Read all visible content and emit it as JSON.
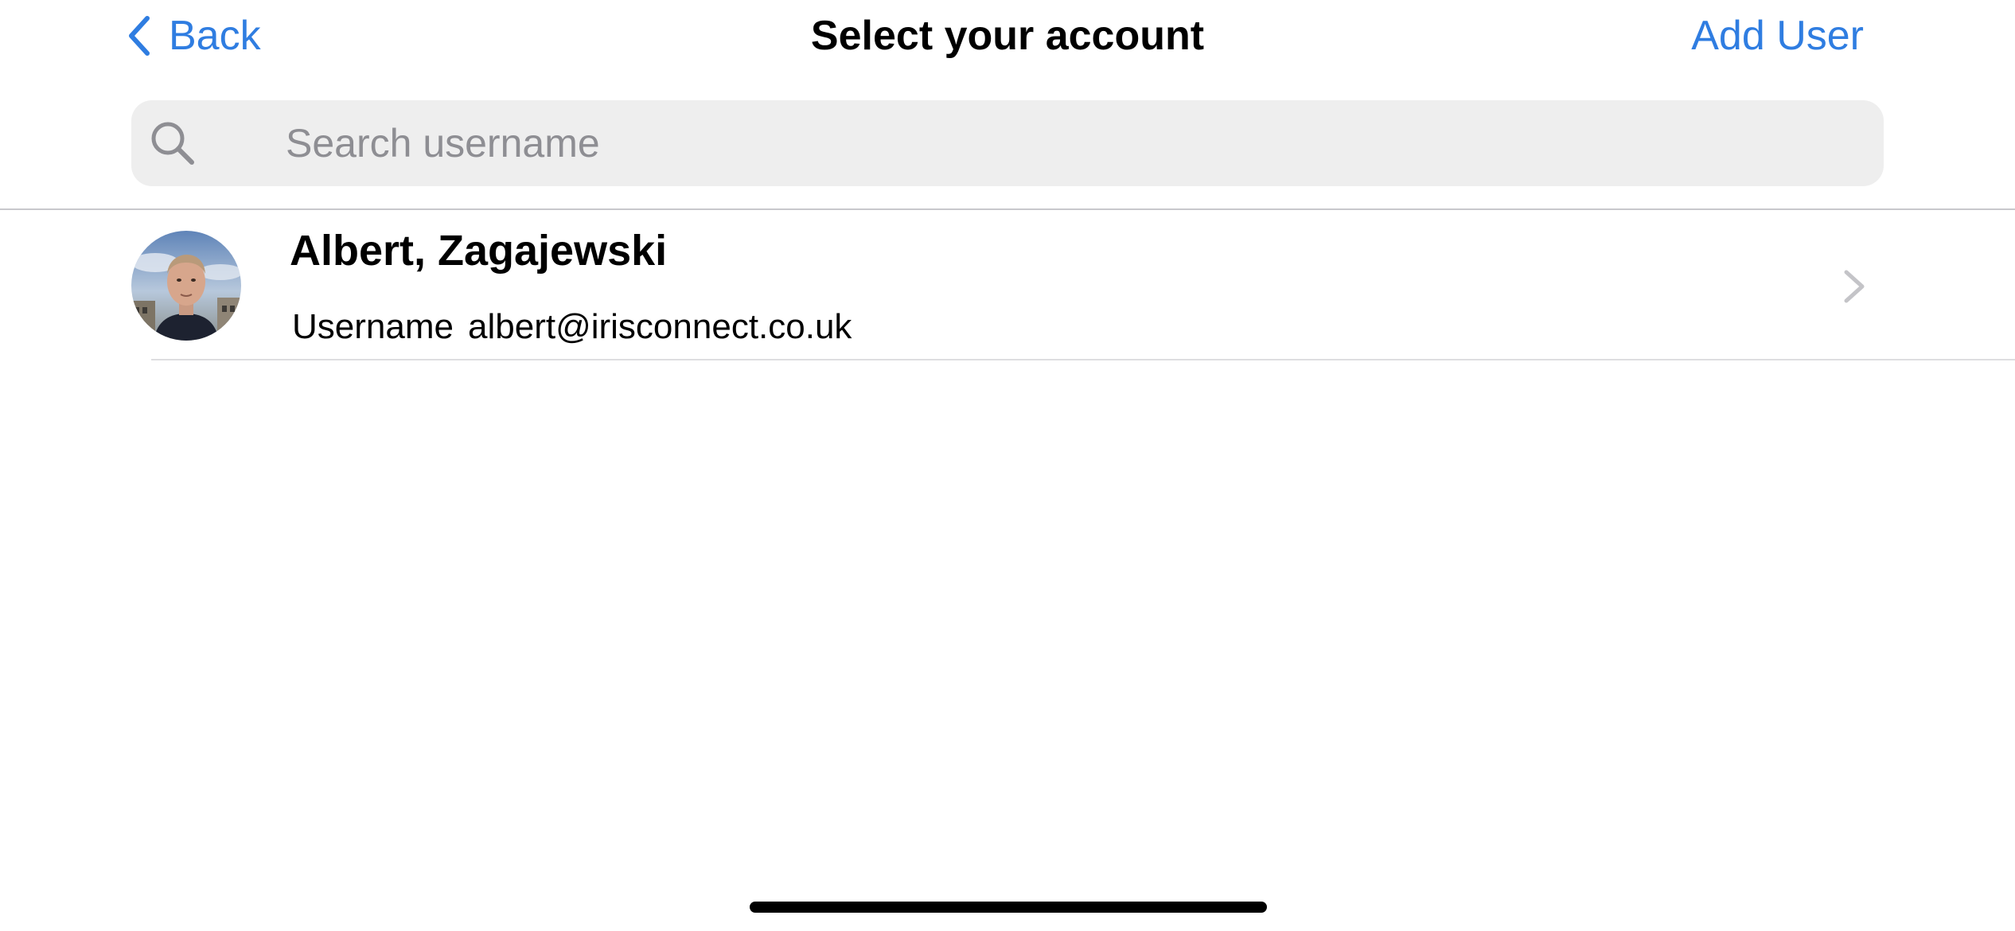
{
  "nav": {
    "back_label": "Back",
    "title": "Select your account",
    "add_user_label": "Add User"
  },
  "search": {
    "placeholder": "Search username",
    "value": ""
  },
  "accounts": [
    {
      "name": "Albert, Zagajewski",
      "username_label": "Username",
      "username": "albert@irisconnect.co.uk"
    }
  ],
  "colors": {
    "accent": "#2f7de1",
    "search_background": "#eeeeee",
    "placeholder": "#8e8e93",
    "divider": "#c8c8cc"
  },
  "icons": {
    "back": "chevron-left-icon",
    "search": "search-icon",
    "row_disclosure": "chevron-right-icon"
  }
}
